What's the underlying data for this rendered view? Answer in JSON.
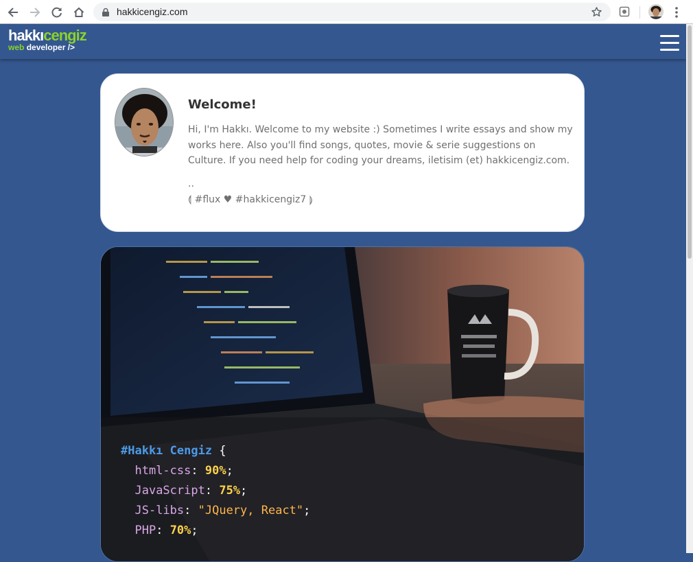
{
  "browser": {
    "url": "hakkicengiz.com"
  },
  "header": {
    "logo_part1": "hakkı",
    "logo_part2": "cengiz",
    "logo_sub1": "web",
    "logo_sub2": "developer />"
  },
  "welcome": {
    "title": "Welcome!",
    "text": "Hi, I'm Hakkı. Welcome to my website :) Sometimes I write essays and show my works here. Also you'll find songs, quotes, movie & serie suggestions on Culture. If you need help for coding your dreams, iletisim (et) hakkicengiz.com.",
    "dots": "..",
    "tags": "⟬ #flux ♥ #hakkicengiz7 ⟭"
  },
  "code": {
    "selector": "#Hakkı Cengiz",
    "open_brace": "{",
    "lines": [
      {
        "prop": "html-css",
        "value": "90%"
      },
      {
        "prop": "JavaScript",
        "value": "75%"
      },
      {
        "prop": "JS-libs",
        "value": "\"JQuery, React\""
      },
      {
        "prop": "PHP",
        "value": "70%"
      }
    ]
  },
  "icons": {
    "back": "back-arrow-icon",
    "forward": "forward-arrow-icon",
    "reload": "reload-icon",
    "home": "home-icon",
    "lock": "lock-icon",
    "bookmark": "star-icon",
    "menu": "hamburger-menu-icon"
  },
  "colors": {
    "page_bg": "#34578f",
    "logo_accent": "#8bd12b",
    "code_selector": "#4c9be8",
    "code_property": "#d9a7e6",
    "code_number": "#ffd24a"
  }
}
